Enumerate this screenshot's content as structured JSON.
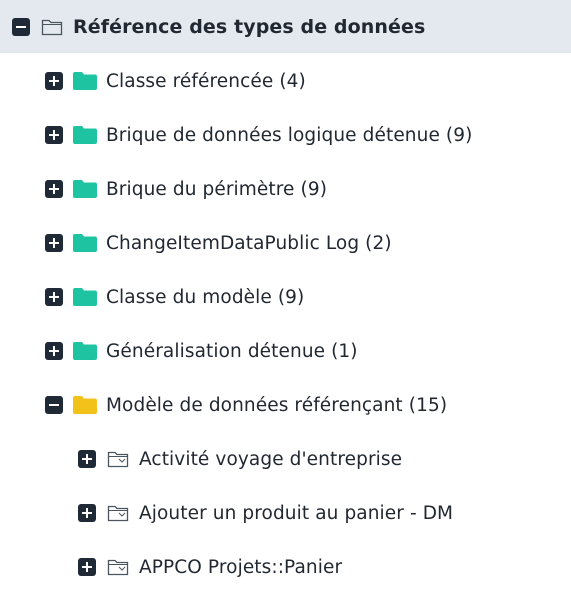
{
  "colors": {
    "root_background": "#e4e8ef",
    "toggle": "#1f2a36",
    "folder_teal": "#1ec4a2",
    "folder_yellow": "#f2c21b",
    "outline_icon": "#4a5560",
    "text": "#222831"
  },
  "tree": {
    "root": {
      "label": "Référence des types de données",
      "toggle": "collapse",
      "icon": "folder-outline-icon"
    },
    "items": [
      {
        "label": "Classe référencée (4)",
        "toggle": "expand",
        "icon": "folder-teal-icon"
      },
      {
        "label": "Brique de données logique détenue (9)",
        "toggle": "expand",
        "icon": "folder-teal-icon"
      },
      {
        "label": "Brique du périmètre (9)",
        "toggle": "expand",
        "icon": "folder-teal-icon"
      },
      {
        "label": "ChangeItemDataPublic Log (2)",
        "toggle": "expand",
        "icon": "folder-teal-icon"
      },
      {
        "label": "Classe du modèle (9)",
        "toggle": "expand",
        "icon": "folder-teal-icon"
      },
      {
        "label": "Généralisation détenue (1)",
        "toggle": "expand",
        "icon": "folder-teal-icon"
      },
      {
        "label": "Modèle de données référençant (15)",
        "toggle": "collapse",
        "icon": "folder-yellow-icon",
        "children": [
          {
            "label": "Activité voyage d'entreprise",
            "toggle": "expand",
            "icon": "data-model-icon"
          },
          {
            "label": "Ajouter un produit au panier - DM",
            "toggle": "expand",
            "icon": "data-model-icon"
          },
          {
            "label": "APPCO Projets::Panier",
            "toggle": "expand",
            "icon": "data-model-icon"
          }
        ]
      }
    ]
  }
}
